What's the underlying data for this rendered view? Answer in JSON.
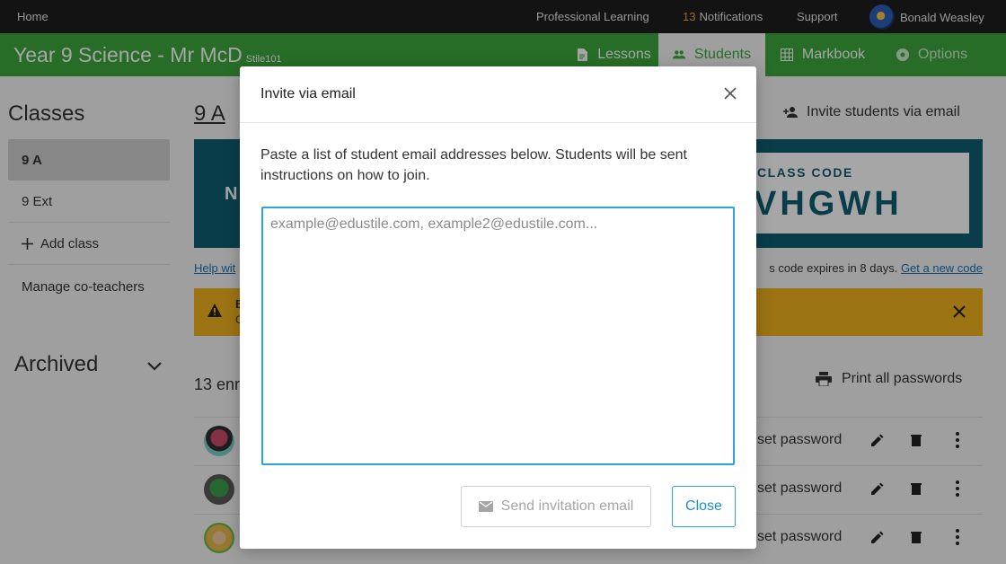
{
  "topbar": {
    "home": "Home",
    "professional_learning": "Professional Learning",
    "notifications_count": "13",
    "notifications_label": "Notifications",
    "support": "Support",
    "user_name": "Bonald Weasley"
  },
  "header": {
    "title": "Year 9 Science - Mr McD",
    "subtitle": "Stile101",
    "tabs": {
      "lessons": "Lessons",
      "students": "Students",
      "markbook": "Markbook",
      "options": "Options"
    }
  },
  "sidebar": {
    "title": "Classes",
    "items": [
      "9 A",
      "9 Ext",
      "Add class",
      "Manage co-teachers"
    ],
    "archived": "Archived"
  },
  "main": {
    "class_title": "9 A",
    "invite_link": "Invite students via email",
    "panel_left_fragment": "N",
    "class_code_label": "CLASS CODE",
    "class_code_fragment": "VHGWH",
    "help_fragment": "Help wit",
    "expires_text": "s code expires in 8 days.",
    "new_code_link": "Get a new code",
    "warning_fragment_1": "E",
    "warning_fragment_2": "C",
    "enrolled_fragment": "13 enr",
    "print_all": "Print all passwords",
    "rows": [
      {
        "reset_fragment": "set password"
      },
      {
        "reset_fragment": "set password"
      },
      {
        "reset_fragment": "set password"
      }
    ]
  },
  "modal": {
    "title": "Invite via email",
    "description": "Paste a list of student email addresses below. Students will be sent instructions on how to join.",
    "textarea_value": "",
    "textarea_placeholder": "example@edustile.com, example2@edustile.com...",
    "send_button": "Send invitation email",
    "close_button": "Close"
  },
  "colors": {
    "header_green": "#3da83d",
    "panel_teal": "#0e5e72",
    "warning_amber": "#f0b31e",
    "accent_blue": "#2aa3d6"
  }
}
